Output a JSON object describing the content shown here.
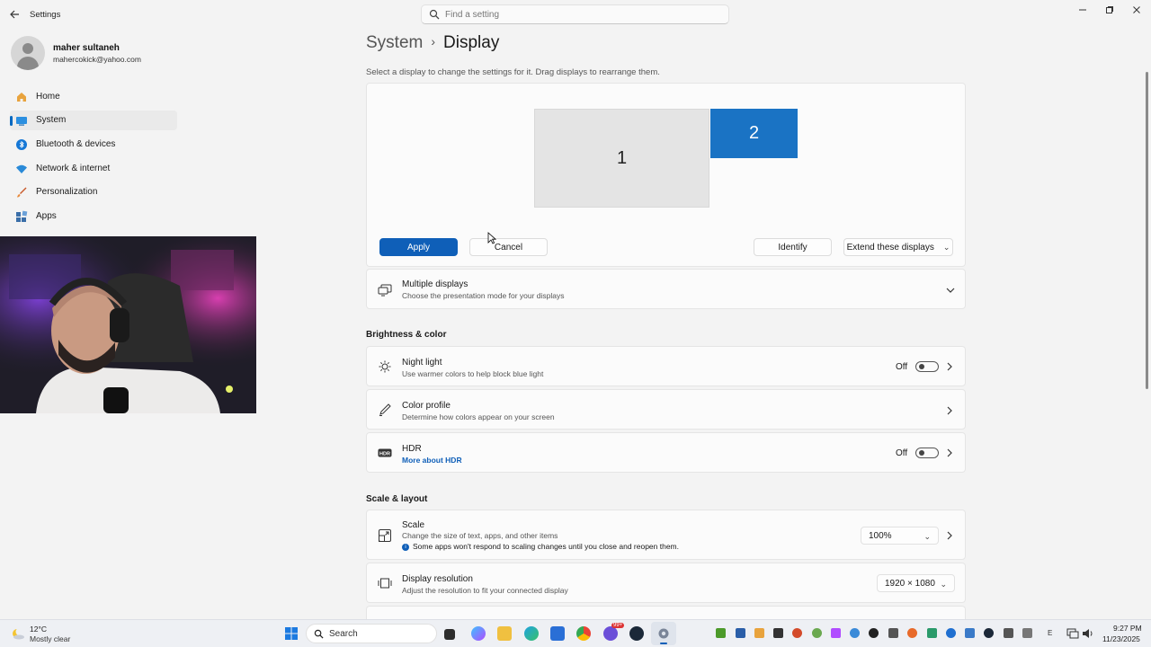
{
  "window": {
    "title": "Settings",
    "search_placeholder": "Find a setting"
  },
  "profile": {
    "name": "maher sultaneh",
    "email": "mahercokick@yahoo.com"
  },
  "sidebar": {
    "items": [
      {
        "label": "Home",
        "icon": "home-icon"
      },
      {
        "label": "System",
        "icon": "system-icon",
        "active": true
      },
      {
        "label": "Bluetooth & devices",
        "icon": "bluetooth-icon"
      },
      {
        "label": "Network & internet",
        "icon": "wifi-icon"
      },
      {
        "label": "Personalization",
        "icon": "brush-icon"
      },
      {
        "label": "Apps",
        "icon": "apps-icon"
      }
    ]
  },
  "header": {
    "breadcrumb_parent": "System",
    "breadcrumb_separator": "›",
    "page_title": "Display",
    "subtitle": "Select a display to change the settings for it. Drag displays to rearrange them."
  },
  "arrangement": {
    "monitor_1": "1",
    "monitor_2": "2",
    "apply_label": "Apply",
    "cancel_label": "Cancel",
    "identify_label": "Identify",
    "mode_value": "Extend these displays"
  },
  "multiple_displays": {
    "title": "Multiple displays",
    "description": "Choose the presentation mode for your displays"
  },
  "brightness_section": {
    "heading": "Brightness & color",
    "night_light": {
      "title": "Night light",
      "description": "Use warmer colors to help block blue light",
      "state": "Off"
    },
    "color_profile": {
      "title": "Color profile",
      "description": "Determine how colors appear on your screen"
    },
    "hdr": {
      "title": "HDR",
      "link": "More about HDR",
      "state": "Off",
      "icon_text": "HDR"
    }
  },
  "scale_section": {
    "heading": "Scale & layout",
    "scale": {
      "title": "Scale",
      "description": "Change the size of text, apps, and other items",
      "info": "Some apps won't respond to scaling changes until you close and reopen them.",
      "value": "100%"
    },
    "resolution": {
      "title": "Display resolution",
      "description": "Adjust the resolution to fit your connected display",
      "value": "1920 × 1080"
    }
  },
  "taskbar": {
    "weather_temp": "12°C",
    "weather_desc": "Mostly clear",
    "search_label": "Search",
    "time": "9:27 PM",
    "date": "11/23/2025",
    "badge": "99+",
    "lang": "E"
  },
  "colors": {
    "accent": "#0f5fb8",
    "monitor_selected": "#1a73c4"
  }
}
